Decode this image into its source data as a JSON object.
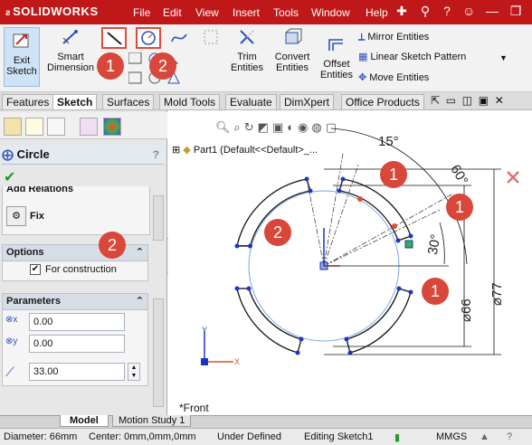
{
  "app": {
    "logo_ds": "ƨ",
    "logo_text": "SOLIDWORKS"
  },
  "menu": [
    "File",
    "Edit",
    "View",
    "Insert",
    "Tools",
    "Window",
    "Help"
  ],
  "commands": {
    "exit_sketch": "Exit\nSketch",
    "smart_dimension": "Smart\nDimension",
    "trim_entities": "Trim\nEntities",
    "convert_entities": "Convert\nEntities",
    "offset_entities": "Offset\nEntities",
    "mirror_entities": "Mirror Entities",
    "linear_pattern": "Linear Sketch Pattern",
    "move_entities": "Move Entities"
  },
  "tabs": [
    "Features",
    "Sketch",
    "Surfaces",
    "Mold Tools",
    "Evaluate",
    "DimXpert",
    "Office Products"
  ],
  "active_tab": "Sketch",
  "property_manager": {
    "title": "Circle",
    "help": "?",
    "add_relations": "Add Relations",
    "fix_label": "Fix",
    "options_title": "Options",
    "for_construction": "For construction",
    "parameters_title": "Parameters",
    "cx": "0.00",
    "cy": "0.00",
    "radius": "33.00"
  },
  "viewport": {
    "tree_label": "Part1  (Default<<Default>_...",
    "view_name": "*Front",
    "dims": {
      "angle15": "15°",
      "angle60": "60°",
      "angle30": "30°",
      "dia77": "⌀77",
      "dia66": "⌀66"
    },
    "axis_x": "X",
    "axis_y": "Y"
  },
  "callouts": [
    "1",
    "2",
    "1",
    "2",
    "1",
    "2",
    "1",
    "1"
  ],
  "bottom_tabs": [
    "Model",
    "Motion Study 1"
  ],
  "status": {
    "diameter": "Diameter: 66mm",
    "center": "Center: 0mm,0mm,0mm",
    "state": "Under Defined",
    "editing": "Editing Sketch1",
    "units": "MMGS"
  },
  "colors": {
    "brand_red": "#c01818",
    "callout_red": "#d8473a",
    "sketch_blue": "#1a34c8",
    "construction_blue": "#7aa7e0"
  }
}
